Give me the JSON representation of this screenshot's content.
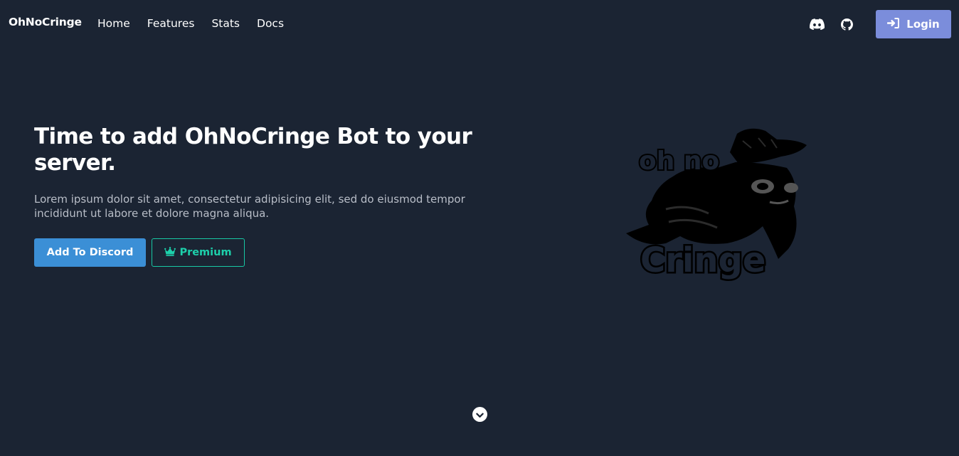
{
  "nav": {
    "brand": "OhNoCringe",
    "links": [
      "Home",
      "Features",
      "Stats",
      "Docs"
    ],
    "login_label": "Login",
    "icons": [
      "discord-icon",
      "github-icon",
      "sign-in-icon"
    ]
  },
  "hero": {
    "title": "Time to add OhNoCringe Bot to your server.",
    "text": "Lorem ipsum dolor sit amet, consectetur adipisicing elit, sed do eiusmod tempor incididunt ut labore et dolore magna aliqua.",
    "add_button": "Add To Discord",
    "premium_button": "Premium",
    "logo_text_top": "oh no",
    "logo_text_bottom": "Cringe"
  },
  "colors": {
    "background": "#1b2433",
    "login_button": "#7b8ddb",
    "discord_button": "#3b8fd6",
    "premium_accent": "#1dd0ab"
  }
}
